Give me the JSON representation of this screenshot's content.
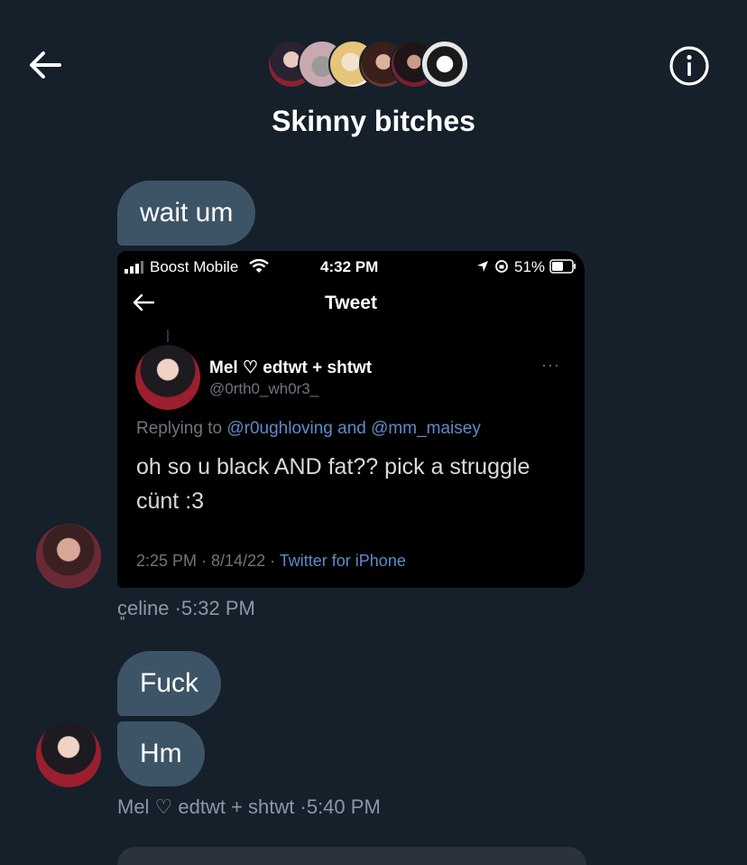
{
  "header": {
    "title": "Skinny bitches",
    "back_icon": "arrow-left-icon",
    "info_icon": "info-icon"
  },
  "messages": {
    "m1": {
      "text": "wait um"
    },
    "screenshot": {
      "status": {
        "carrier": "Boost Mobile",
        "time": "4:32 PM",
        "battery": "51%"
      },
      "nav_title": "Tweet",
      "author_name": "Mel ♡ edtwt + shtwt",
      "author_handle": "@0rth0_wh0r3_",
      "reply_prefix": "Replying to",
      "reply_users": "@r0ughloving and @mm_maisey",
      "tweet_text": "oh so u black AND fat?? pick a struggle cünt :3",
      "timestamp": "2:25 PM · 8/14/22 ·",
      "source": "Twitter for iPhone"
    },
    "meta1": "c͈eline ·5:32 PM",
    "m2": {
      "text": "Fuck"
    },
    "m3": {
      "text": "Hm"
    },
    "meta2": "Mel ♡ edtwt + shtwt ·5:40 PM"
  },
  "colors": {
    "background": "#15202b",
    "bubble": "#3d5466",
    "meta": "#8b98a5",
    "link": "#5d8cc9"
  }
}
